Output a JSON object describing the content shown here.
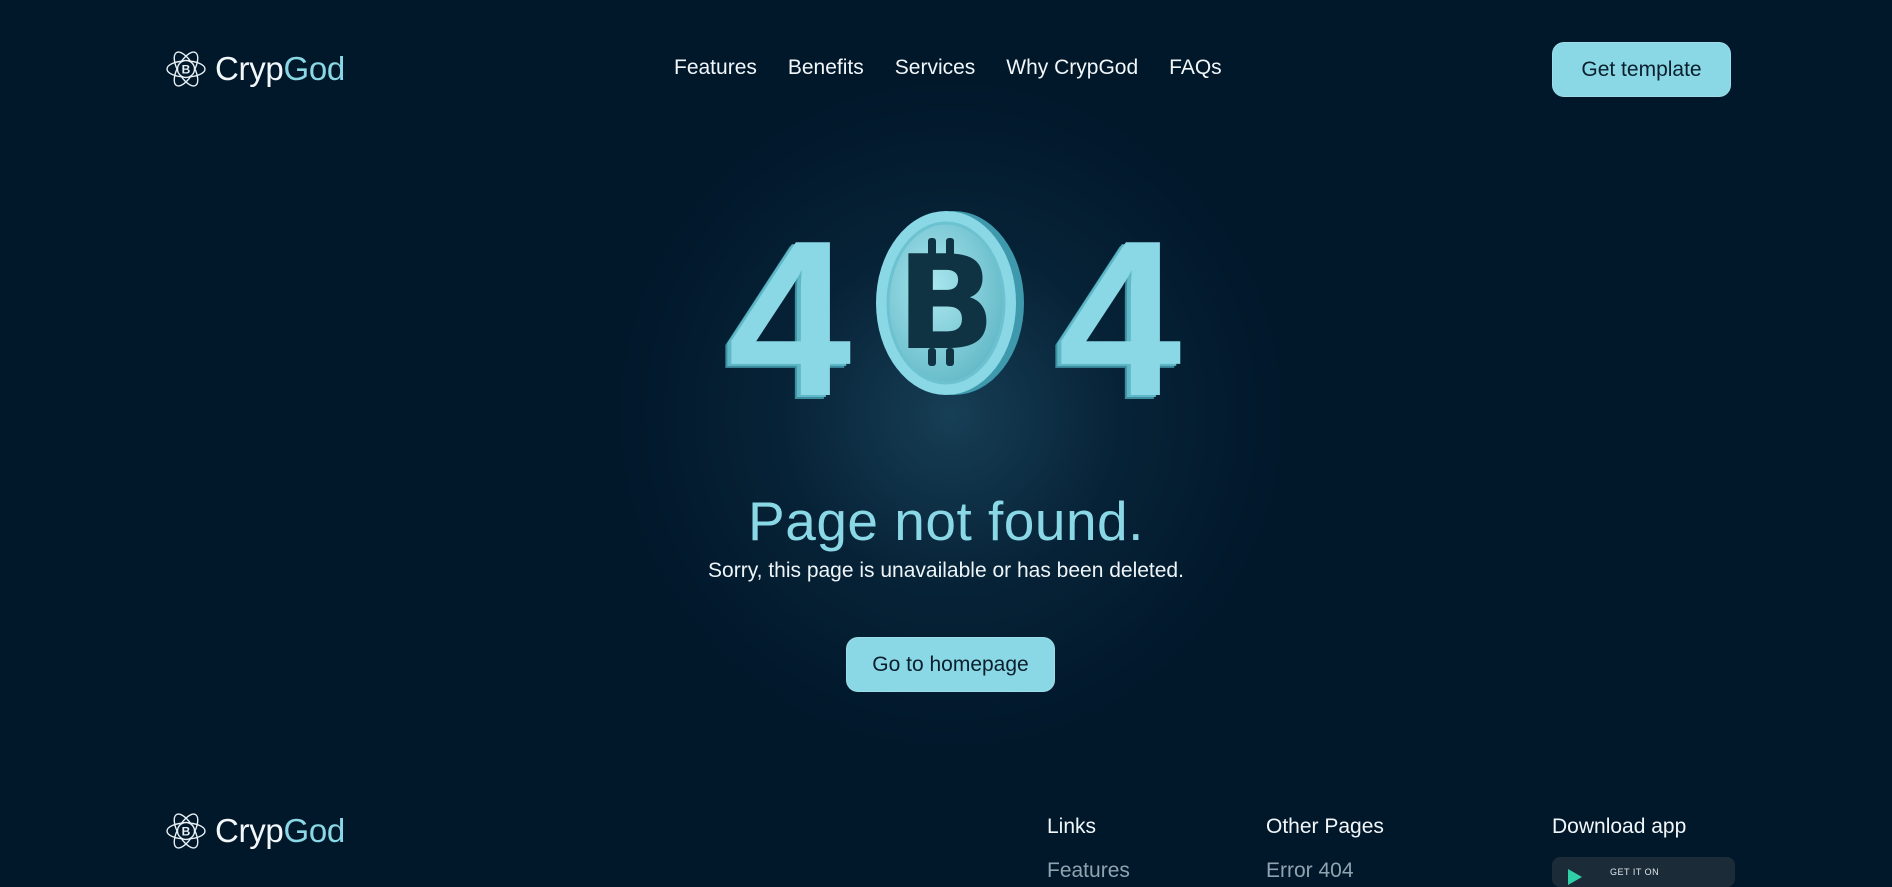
{
  "header": {
    "logo": {
      "brand_part1": "Cryp",
      "brand_part2": "God",
      "icon": "atom-bitcoin-icon"
    },
    "nav": [
      "Features",
      "Benefits",
      "Services",
      "Why CrypGod",
      "FAQs"
    ],
    "cta_label": "Get template"
  },
  "hero": {
    "code_left": "4",
    "code_right": "4",
    "coin_icon": "bitcoin-coin-icon",
    "title": "Page not found.",
    "subtitle": "Sorry, this page is unavailable or has been deleted.",
    "button_label": "Go to homepage"
  },
  "footer": {
    "logo": {
      "brand_part1": "Cryp",
      "brand_part2": "God"
    },
    "links_heading": "Links",
    "links": [
      "Features"
    ],
    "other_heading": "Other Pages",
    "other_links": [
      "Error 404"
    ],
    "download_heading": "Download app",
    "badge_text": "GET IT ON",
    "badge_icon": "google-play-icon"
  },
  "colors": {
    "background": "#01172a",
    "accent": "#8ad8e6",
    "text": "#f2f7fa",
    "muted": "#8fa3b0"
  }
}
